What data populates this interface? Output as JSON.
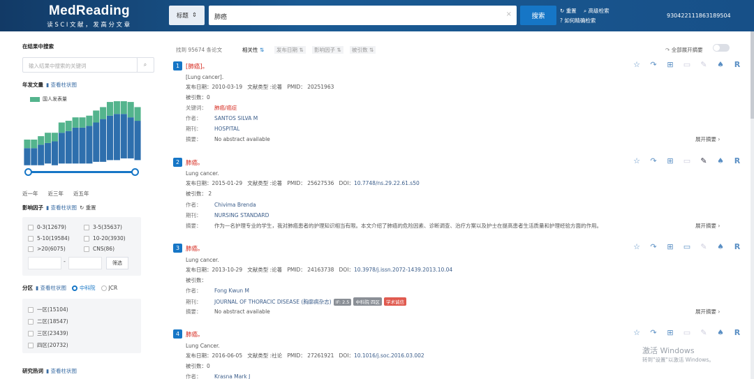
{
  "header": {
    "logo": "MedReading",
    "slogan": "读SCI文献，发高分文章",
    "field": "标题",
    "query": "肺癌",
    "clear": "×",
    "search_btn": "搜索",
    "reset": "重置",
    "advanced": "高级检索",
    "precise": "如何精确检索",
    "user_id": "930422111863189504"
  },
  "sidebar": {
    "search_title": "在结果中搜索",
    "search_placeholder": "输入结果中搜索的关键词",
    "year_title": "年发文量",
    "view_bar": "查看柱状图",
    "legend": "国人发表量",
    "ranges": [
      "近一年",
      "近三年",
      "近五年"
    ],
    "if_title": "影响因子",
    "if_view": "查看柱状图",
    "if_reset": "重置",
    "if_opts": [
      "0-3(12679)",
      "3-5(35637)",
      "5-10(19584)",
      "10-20(3930)",
      ">20(6075)",
      "CNS(86)"
    ],
    "filter_btn": "筛选",
    "dash": "-",
    "zone_title": "分区",
    "zone_view": "查看柱状图",
    "zone_cas": "中科院",
    "zone_jcr": "JCR",
    "zones": [
      "一区(15104)",
      "二区(18547)",
      "三区(23439)",
      "四区(20732)"
    ],
    "hot_title": "研究热词",
    "hot_view": "查看柱状图",
    "chart_data": {
      "type": "bar",
      "total": [
        15,
        15,
        17,
        18,
        19,
        24,
        25,
        27,
        27,
        28,
        30,
        32,
        34,
        35,
        35,
        33,
        31
      ],
      "china": [
        5,
        5,
        5,
        6,
        5,
        6,
        6,
        6,
        6,
        6,
        7,
        7,
        8,
        8,
        9,
        9,
        8
      ],
      "colors": {
        "total": "#2e6fad",
        "china": "#54b48d"
      }
    }
  },
  "toolbar": {
    "found": "找到 95674 条论文",
    "sorts": [
      "相关性",
      "发布日期",
      "影响因子",
      "被引数"
    ],
    "expand_all": "全部展开摘要"
  },
  "labels": {
    "date": "发布日期：",
    "type": "文献类型 :",
    "pmid": "PMID：",
    "doi": "DOI：",
    "cited": "被引数：",
    "keywords": "关键词：",
    "author": "作者：",
    "journal": "期刊：",
    "abstract": "摘要：",
    "expand": "展开摘要"
  },
  "results": [
    {
      "no": "1",
      "title": "[肺癌]。",
      "orig": "[Lung cancer].",
      "date": "2010-03-19",
      "type": "论著",
      "pmid": "20251963",
      "doi": "",
      "cited": "0",
      "keywords": "肺癌/癌症",
      "authors": "SANTOS SILVA M",
      "journal": "HOSPITAL",
      "abstract": "No abstract available"
    },
    {
      "no": "2",
      "title": "肺癌。",
      "orig": "Lung cancer.",
      "date": "2015-01-29",
      "type": "论著",
      "pmid": "25627536",
      "doi": "10.7748/ns.29.22.61.s50",
      "cited": "2",
      "authors": "Chivima Brenda",
      "journal": "NURSING STANDARD",
      "abstract": "作为一名护理专业的学生，我对肺癌患者的护理知识相当有限。本文介绍了肺癌的危险因素、诊断调查、治疗方案以及护士在提高患者生活质量和护理经验方面的作用。"
    },
    {
      "no": "3",
      "title": "肺癌。",
      "orig": "Lung cancer.",
      "date": "2013-10-29",
      "type": "论著",
      "pmid": "24163738",
      "doi": "10.3978/j.issn.2072-1439.2013.10.04",
      "cited": "",
      "authors": "Fong Kwun M",
      "journal": "JOURNAL OF THORACIC DISEASE (胸廓病杂志)",
      "tags": [
        "IF: 2.5",
        "中科院 四区",
        "学术诚信"
      ],
      "abstract": "No abstract available"
    },
    {
      "no": "4",
      "title": "肺癌。",
      "orig": "Lung Cancer.",
      "date": "2016-06-05",
      "type": "社论",
      "pmid": "27261921",
      "doi": "10.1016/j.soc.2016.03.002",
      "cited": "0",
      "authors": "Krasna Mark J"
    }
  ],
  "watermark": {
    "line1": "激活 Windows",
    "line2": "转到\"设置\"以激活 Windows。"
  }
}
